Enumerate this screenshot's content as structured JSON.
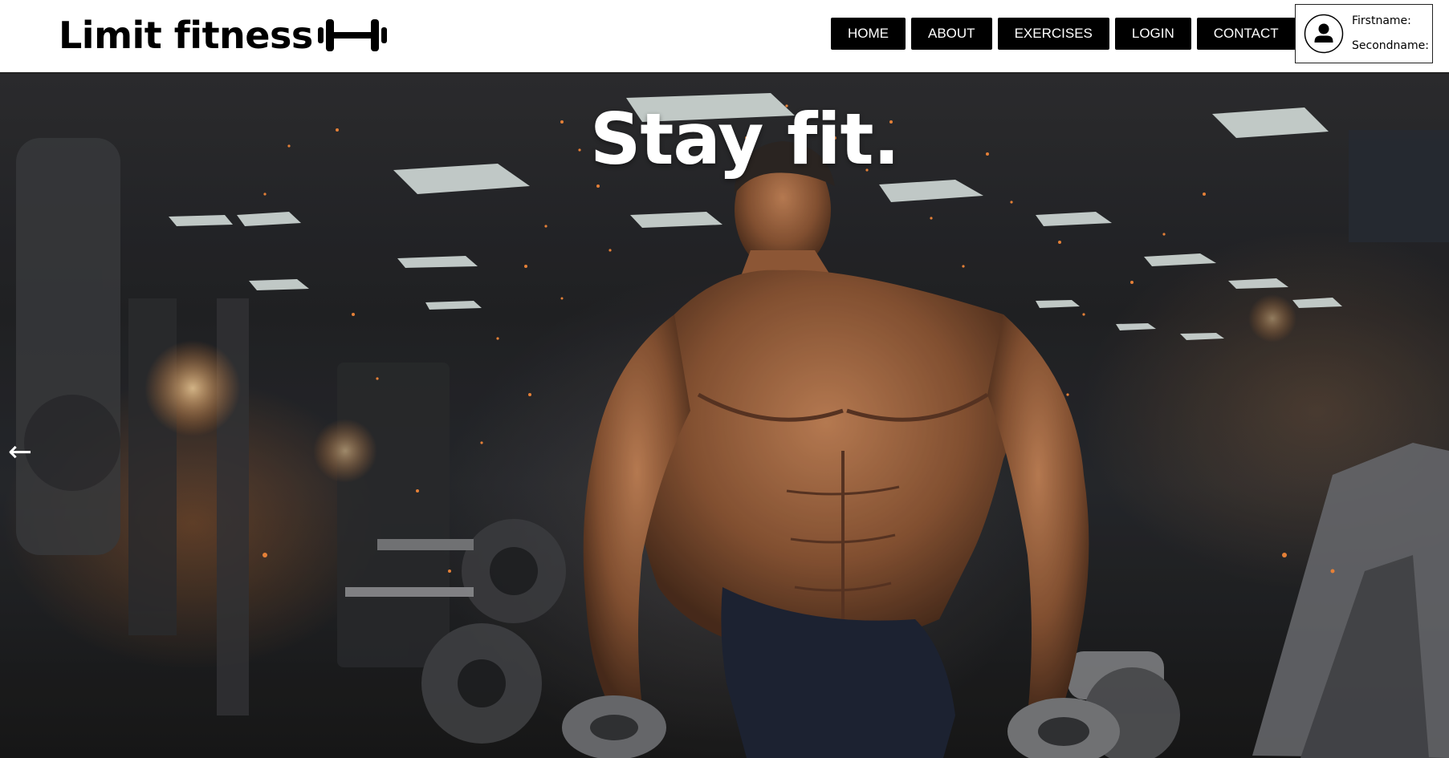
{
  "brand": {
    "name": "Limit fitness",
    "logo_icon": "dumbbell-icon"
  },
  "nav": {
    "items": [
      {
        "label": "HOME"
      },
      {
        "label": "ABOUT"
      },
      {
        "label": "EXERCISES"
      },
      {
        "label": "LOGIN"
      },
      {
        "label": "CONTACT"
      }
    ]
  },
  "user": {
    "avatar_icon": "user-avatar-icon",
    "firstname_label": "Firstname:",
    "secondname_label": "Secondname:"
  },
  "hero": {
    "title": "Stay fit.",
    "prev_arrow": "←",
    "image": "gym-bodybuilder-photo"
  },
  "colors": {
    "nav_bg": "#000000",
    "nav_text": "#ffffff",
    "header_bg": "#ffffff"
  }
}
